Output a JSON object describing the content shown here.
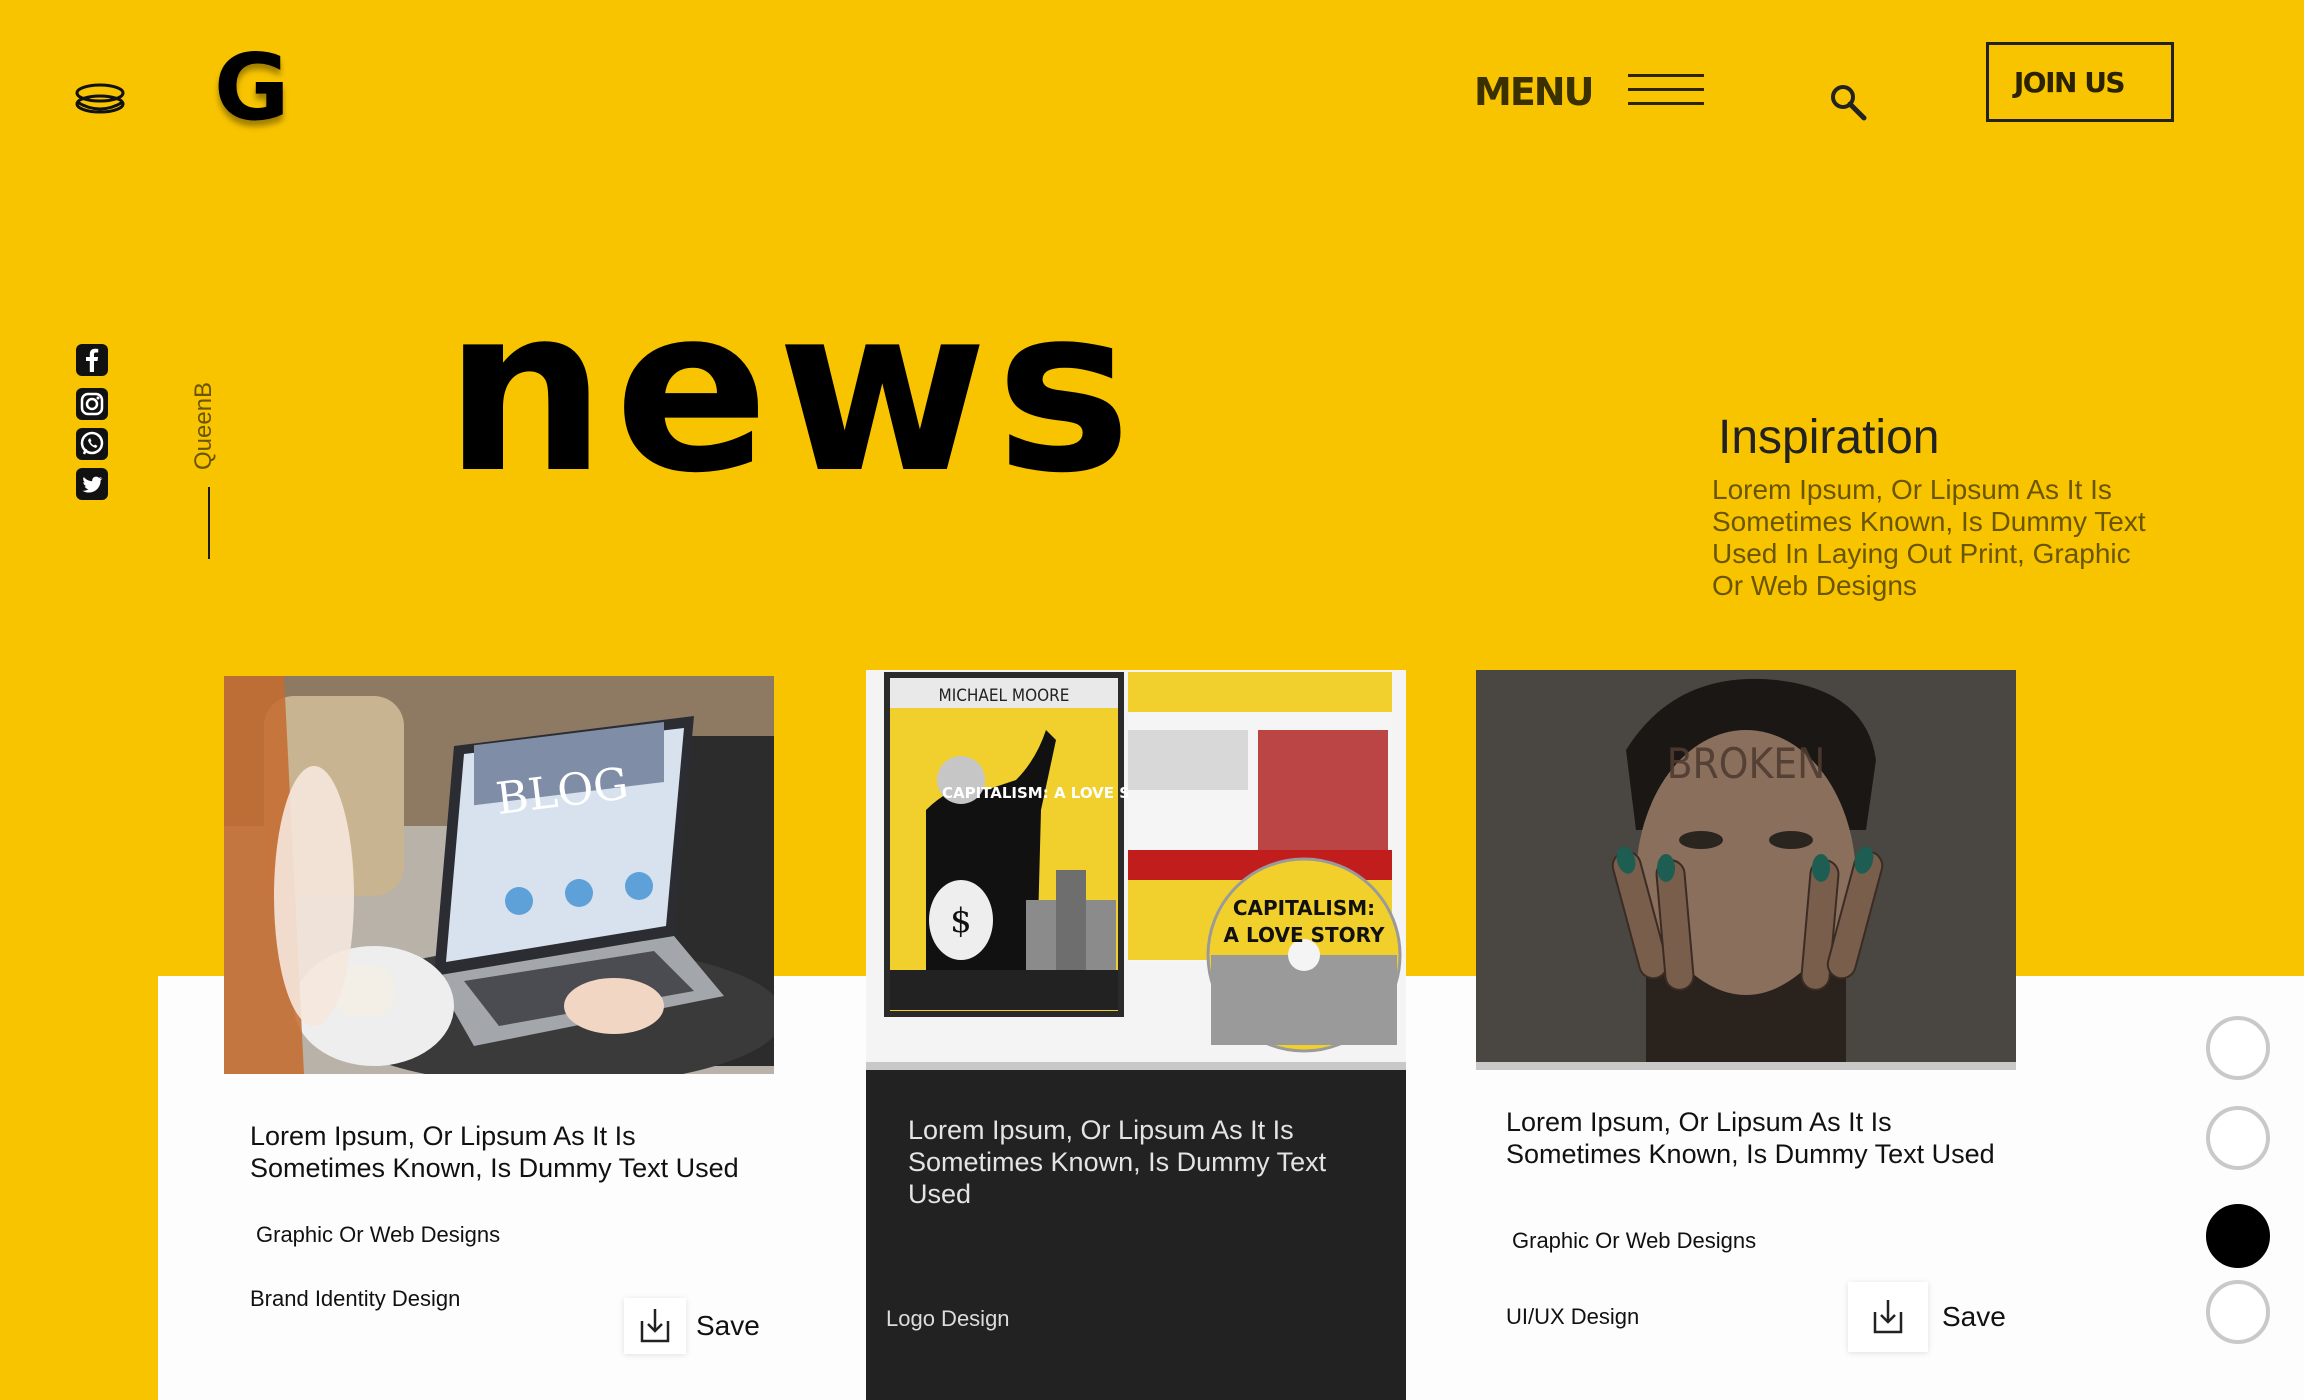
{
  "header": {
    "logo_letter": "G",
    "menu_label": "MENU",
    "join_label": "JOIN US"
  },
  "social": {
    "icons": [
      "facebook-icon",
      "instagram-icon",
      "whatsapp-icon",
      "twitter-icon"
    ]
  },
  "sidebar": {
    "vertical_name": "QueenB"
  },
  "hero": {
    "headline": "news"
  },
  "inspiration": {
    "title": "Inspiration",
    "body": "Lorem Ipsum, Or Lipsum As It Is Sometimes Known, Is Dummy Text Used In Laying Out Print, Graphic Or Web Designs"
  },
  "cards": [
    {
      "title": "Lorem Ipsum, Or Lipsum As It Is Sometimes Known, Is Dummy Text Used",
      "subtitle": "Graphic Or Web Designs",
      "category": "Brand Identity Design",
      "save_label": "Save",
      "image_text": "BLOG"
    },
    {
      "title": "Lorem Ipsum, Or Lipsum As It Is Sometimes Known, Is Dummy Text Used",
      "category": "Logo Design",
      "image_text_top": "MICHAEL MOORE",
      "image_text_title": "CAPITALISM: A LOVE STORY"
    },
    {
      "title": "Lorem Ipsum, Or Lipsum As It Is Sometimes Known, Is Dummy Text Used",
      "subtitle": "Graphic Or Web Designs",
      "category": "UI/UX Design",
      "save_label": "Save",
      "image_text": "BROKEN"
    }
  ],
  "pagination": {
    "count": 4,
    "active_index": 2
  },
  "colors": {
    "accent": "#F8C400",
    "dark_card": "#222222",
    "white": "#FDFDFD"
  }
}
